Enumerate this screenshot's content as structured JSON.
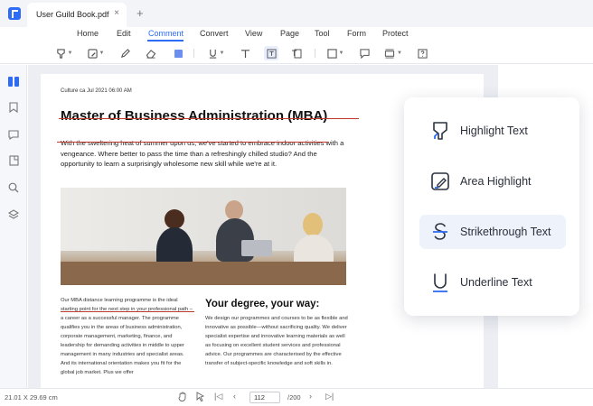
{
  "tab": {
    "title": "User Guild Book.pdf",
    "close": "×",
    "new_tab": "+"
  },
  "menu": [
    "Home",
    "Edit",
    "Comment",
    "Convert",
    "View",
    "Page",
    "Tool",
    "Form",
    "Protect"
  ],
  "menu_active": "Comment",
  "document": {
    "meta": "Culture ca Jul 2021 06:00 AM",
    "title": "Master of Business Administration (MBA)",
    "intro": "With the sweltering heat of summer upon us, we've started to embrace indoor activities with a vengeance. Where better to pass the time than a refreshingly chilled studio? And the opportunity to learn a surprisingly wholesome new skill while we're at it.",
    "col1": "Our MBA distance learning programme is the ideal starting point for the next step in your professional path – a career as a successful manager. The programme qualifies you in the areas of business administration, corporate management, marketing, finance, and leadership for demanding activities in middle to upper management in many industries and specialist areas. And its international orientation makes you fit for the global job market. Plus we offer",
    "col2_title": "Your degree, your way:",
    "col2": "We design our programmes and courses to be as flexible and innovative as possible—without sacrificing quality. We deliver specialist expertise and innovative learning materials as well as focusing on excellent student services and professional advice. Our programmes are characterised by the effective transfer of subject-specific knowledge and soft skills in."
  },
  "popup": {
    "items": [
      {
        "label": "Highlight Text",
        "icon": "highlight-text-icon"
      },
      {
        "label": "Area Highlight",
        "icon": "area-highlight-icon"
      },
      {
        "label": "Strikethrough Text",
        "icon": "strikethrough-text-icon"
      },
      {
        "label": "Underline Text",
        "icon": "underline-text-icon"
      }
    ],
    "active": "Strikethrough Text"
  },
  "status": {
    "size": "21.01 X 29.69 cm",
    "page_current": "112",
    "page_total": "/200"
  },
  "colors": {
    "accent": "#2d6cf6",
    "annotation_red": "#c0392b"
  }
}
